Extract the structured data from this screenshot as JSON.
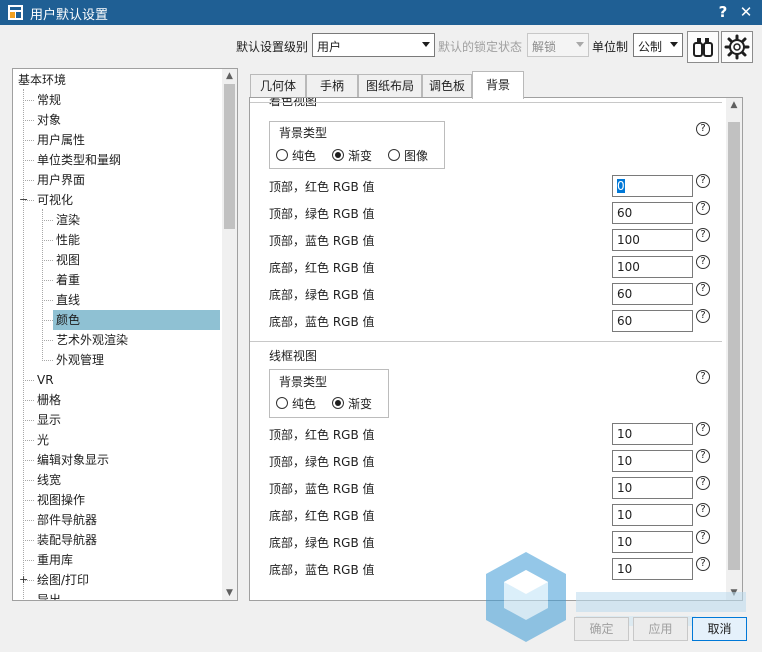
{
  "window": {
    "title": "用户默认设置",
    "help_label": "?",
    "close_label": "✕"
  },
  "toolbar": {
    "level_label": "默认设置级别",
    "level_value": "用户",
    "lock_label": "默认的锁定状态",
    "lock_value": "解锁",
    "unit_label": "单位制",
    "unit_value": "公制",
    "search_icon": "binoculars-icon",
    "settings_icon": "gear-icon"
  },
  "tree": {
    "items": [
      {
        "label": "基本环境"
      },
      {
        "label": "常规"
      },
      {
        "label": "对象"
      },
      {
        "label": "用户属性"
      },
      {
        "label": "单位类型和量纲"
      },
      {
        "label": "用户界面"
      },
      {
        "label": "可视化",
        "expander": "−"
      },
      {
        "label": "渲染"
      },
      {
        "label": "性能"
      },
      {
        "label": "视图"
      },
      {
        "label": "着重"
      },
      {
        "label": "直线"
      },
      {
        "label": "颜色",
        "selected": true
      },
      {
        "label": "艺术外观渲染"
      },
      {
        "label": "外观管理"
      },
      {
        "label": "VR"
      },
      {
        "label": "栅格"
      },
      {
        "label": "显示"
      },
      {
        "label": "光"
      },
      {
        "label": "编辑对象显示"
      },
      {
        "label": "线宽"
      },
      {
        "label": "视图操作"
      },
      {
        "label": "部件导航器"
      },
      {
        "label": "装配导航器"
      },
      {
        "label": "重用库"
      },
      {
        "label": "绘图/打印",
        "expander": "+"
      },
      {
        "label": "导出"
      }
    ]
  },
  "tabs": [
    "几何体",
    "手柄",
    "图纸布局",
    "调色板",
    "背景"
  ],
  "active_tab": "背景",
  "shaded": {
    "title": "着色视图",
    "bg_type_label": "背景类型",
    "options": [
      "纯色",
      "渐变",
      "图像"
    ],
    "selected": "渐变",
    "fields": [
      {
        "label": "顶部，红色 RGB 值",
        "value": "0"
      },
      {
        "label": "顶部，绿色 RGB 值",
        "value": "60"
      },
      {
        "label": "顶部，蓝色 RGB 值",
        "value": "100"
      },
      {
        "label": "底部，红色 RGB 值",
        "value": "100"
      },
      {
        "label": "底部，绿色 RGB 值",
        "value": "60"
      },
      {
        "label": "底部，蓝色 RGB 值",
        "value": "60"
      }
    ]
  },
  "wireframe": {
    "title": "线框视图",
    "bg_type_label": "背景类型",
    "options": [
      "纯色",
      "渐变"
    ],
    "selected": "渐变",
    "fields": [
      {
        "label": "顶部，红色 RGB 值",
        "value": "10"
      },
      {
        "label": "顶部，绿色 RGB 值",
        "value": "10"
      },
      {
        "label": "顶部，蓝色 RGB 值",
        "value": "10"
      },
      {
        "label": "底部，红色 RGB 值",
        "value": "10"
      },
      {
        "label": "底部，绿色 RGB 值",
        "value": "10"
      },
      {
        "label": "底部，蓝色 RGB 值",
        "value": "10"
      }
    ]
  },
  "help_glyph": "?",
  "buttons": {
    "ok": "确定",
    "apply": "应用",
    "cancel": "取消"
  },
  "colors": {
    "titlebar": "#1f5f94",
    "selection": "#8fc1d3",
    "accent": "#0078d7"
  }
}
